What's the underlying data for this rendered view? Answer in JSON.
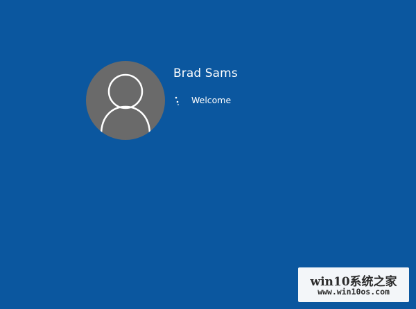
{
  "lock_screen": {
    "user": {
      "name": "Brad Sams",
      "avatar_icon": "default-user-icon"
    },
    "status": {
      "text": "Welcome",
      "icon": "loading-spinner-icon"
    },
    "background_color": "#0b579f",
    "avatar_color": "#6a6a6a"
  },
  "watermark": {
    "title": "win10系统之家",
    "url": "www.win10os.com"
  }
}
